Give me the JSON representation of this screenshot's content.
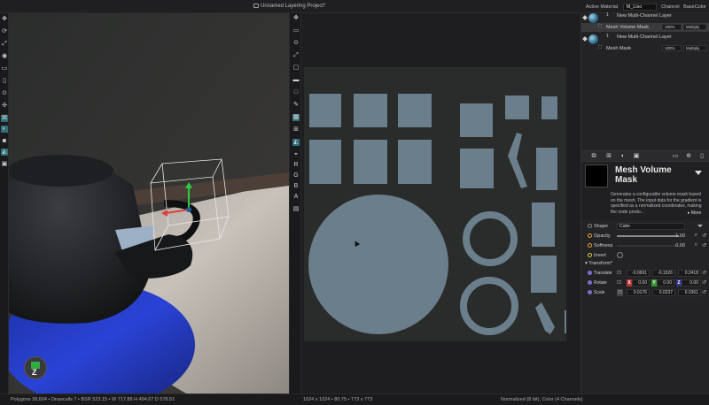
{
  "titlebar": {
    "project": "Unnamed Layering Project*",
    "active_material_label": "Active Material",
    "material_name": "M_Liso",
    "channel_label": "Channel",
    "channel_value": "BaseColor"
  },
  "layers": [
    {
      "num": "1",
      "name": "New Multi-Channel Layer",
      "mask": {
        "name": "Mesh Volume Mask",
        "opacity": "100%",
        "blend": "Multiply"
      }
    },
    {
      "num": "1",
      "name": "New Multi-Channel Layer",
      "mask": {
        "name": "Mesh Mask",
        "opacity": "100%",
        "blend": "Multiply"
      }
    }
  ],
  "node": {
    "title": "Mesh Volume Mask",
    "description": "Generates a configurable volume mask based on the mesh. The input data for the gradient is specified as a normalized coordinates, making the node produ...",
    "more": "More"
  },
  "properties": {
    "shape": {
      "label": "Shape",
      "value": "Cube"
    },
    "opacity": {
      "label": "Opacity",
      "value": "1.00",
      "fill": 1.0
    },
    "softness": {
      "label": "Softness",
      "value": "0.00",
      "fill": 0.0
    },
    "invert": {
      "label": "Invert"
    },
    "transform_label": "Transform*",
    "translate": {
      "label": "Translate",
      "x": "-0.0691",
      "y": "-0.1526",
      "z": "0.2418"
    },
    "rotate": {
      "label": "Rotate",
      "x": "0.00",
      "y": "0.00",
      "z": "0.00"
    },
    "scale": {
      "label": "Scale",
      "x": "0.0176",
      "y": "0.0237",
      "z": "0.0361"
    }
  },
  "status": {
    "left": "Polygons 38,604 • Drawcalls 7 • BSR 523.15 • W 717.88 H 494.67 D 578.51",
    "mid": "1024 x 1024 • 80.75 • 773 x 773",
    "right": "Normalized (8 bit), Color (4 Channels)"
  },
  "gizmo_label": "Z",
  "colors": {
    "accent": "#2f6f78",
    "uv_shell": "#6b7e8c",
    "background": "#1c1c1e"
  }
}
